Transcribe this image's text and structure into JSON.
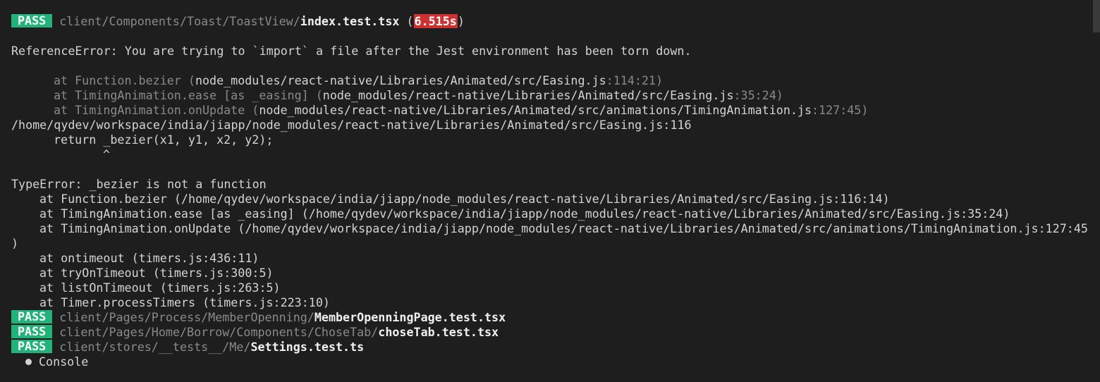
{
  "colors": {
    "background": "#1e1e1e",
    "pass_badge": "#23b37a",
    "time_badge": "#cd3131",
    "dim_text": "#8a8a8a",
    "text": "#d4d4d4"
  },
  "first_test": {
    "status": "PASS",
    "path": "client/Components/Toast/ToastView/",
    "file": "index.test.tsx",
    "open_paren": " (",
    "duration": "6.515s",
    "close_paren": ")"
  },
  "reference_error": {
    "message": "ReferenceError: You are trying to `import` a file after the Jest environment has been torn down.",
    "frames": [
      {
        "at": "at Function.bezier (",
        "path": "node_modules/react-native/Libraries/Animated/src/Easing.js",
        "pos": ":114:21)",
        "close": ")"
      },
      {
        "at": "at TimingAnimation.ease [as _easing] (",
        "path": "node_modules/react-native/Libraries/Animated/src/Easing.js",
        "pos": ":35:24)",
        "close": ")"
      },
      {
        "at": "at TimingAnimation.onUpdate (",
        "path": "node_modules/react-native/Libraries/Animated/src/animations/TimingAnimation.js",
        "pos": ":127:45)",
        "close": ")"
      }
    ],
    "source_location": "/home/qydev/workspace/india/jiapp/node_modules/react-native/Libraries/Animated/src/Easing.js:116",
    "source_code": "return _bezier(x1, y1, x2, y2);",
    "caret": "^"
  },
  "type_error": {
    "message": "TypeError: _bezier is not a function",
    "frames": [
      "at Function.bezier (/home/qydev/workspace/india/jiapp/node_modules/react-native/Libraries/Animated/src/Easing.js:116:14)",
      "at TimingAnimation.ease [as _easing] (/home/qydev/workspace/india/jiapp/node_modules/react-native/Libraries/Animated/src/Easing.js:35:24)",
      "at TimingAnimation.onUpdate (/home/qydev/workspace/india/jiapp/node_modules/react-native/Libraries/Animated/src/animations/TimingAnimation.js:127:45",
      ")",
      "at ontimeout (timers.js:436:11)",
      "at tryOnTimeout (timers.js:300:5)",
      "at listOnTimeout (timers.js:263:5)",
      "at Timer.processTimers (timers.js:223:10)"
    ]
  },
  "passes": [
    {
      "status": "PASS",
      "path": "client/Pages/Process/MemberOpenning/",
      "file": "MemberOpenningPage.test.tsx"
    },
    {
      "status": "PASS",
      "path": "client/Pages/Home/Borrow/Components/ChoseTab/",
      "file": "choseTab.test.tsx"
    },
    {
      "status": "PASS",
      "path": "client/stores/__tests__/Me/",
      "file": "Settings.test.ts"
    }
  ],
  "console_label": "Console"
}
